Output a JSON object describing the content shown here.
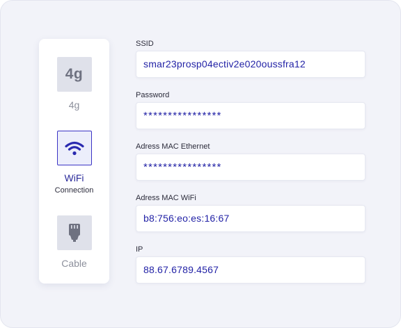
{
  "connection_options": [
    {
      "tile_text": "4g",
      "label": "4g",
      "sublabel": "",
      "icon": "4g-icon",
      "selected": false
    },
    {
      "tile_text": "",
      "label": "WiFi",
      "sublabel": "Connection",
      "icon": "wifi-icon",
      "selected": true
    },
    {
      "tile_text": "",
      "label": "Cable",
      "sublabel": "",
      "icon": "ethernet-cable-icon",
      "selected": false
    }
  ],
  "fields": [
    {
      "label": "SSID",
      "value": "smar23prosp04ectiv2e020oussfra12"
    },
    {
      "label": "Password",
      "value": "****************"
    },
    {
      "label": "Adress MAC Ethernet",
      "value": "****************"
    },
    {
      "label": "Adress MAC WiFi",
      "value": "b8:756:eo:es:16:67"
    },
    {
      "label": "IP",
      "value": "88.67.6789.4567"
    }
  ],
  "colors": {
    "accent": "#2222a6",
    "panel_bg": "#f2f3f9",
    "tile_bg": "#dfe1ea",
    "selected_border": "#3a33c4",
    "icon_gray": "#6e7180"
  }
}
